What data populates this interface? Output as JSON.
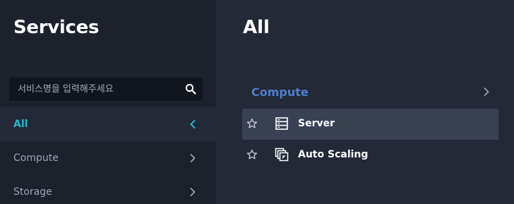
{
  "sidebar": {
    "title": "Services",
    "search": {
      "placeholder": "서비스명을 입력해주세요",
      "value": ""
    },
    "items": [
      {
        "label": "All",
        "active": true,
        "chevron": "chevron-left-icon"
      },
      {
        "label": "Compute",
        "active": false,
        "chevron": "chevron-right-icon"
      },
      {
        "label": "Storage",
        "active": false,
        "chevron": "chevron-right-icon"
      }
    ]
  },
  "main": {
    "title": "All",
    "category": {
      "label": "Compute",
      "chevron": "chevron-right-icon"
    },
    "services": [
      {
        "label": "Server",
        "icon": "server-icon",
        "favorite_icon": "star-outline-icon",
        "highlighted": true
      },
      {
        "label": "Auto Scaling",
        "icon": "auto-scaling-icon",
        "favorite_icon": "star-outline-icon",
        "highlighted": false
      }
    ]
  },
  "colors": {
    "background": "#232936",
    "sidebar": "#1c212c",
    "search_bg": "#11151d",
    "active_accent": "#27b7c9",
    "category_accent": "#4c80d0",
    "highlight_row": "#3a4153",
    "nav_text": "#9aa3b5"
  }
}
